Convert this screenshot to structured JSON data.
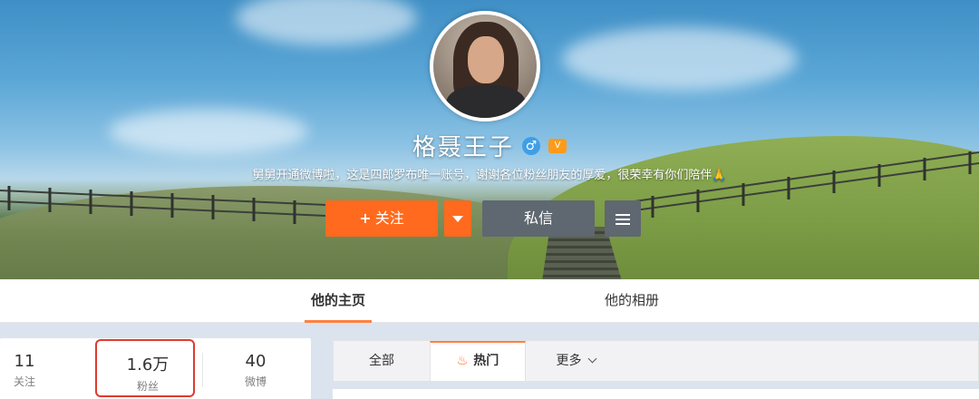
{
  "profile": {
    "name": "格聂王子",
    "gender_icon": "♂",
    "vip_icon": "vip-badge",
    "bio": "舅舅开通微博啦，这是四郎罗布唯一账号，谢谢各位粉丝朋友的厚爱，很荣幸有你们陪伴🙏"
  },
  "actions": {
    "follow_plus": "+",
    "follow_label": "关注",
    "message_label": "私信"
  },
  "tabs": [
    {
      "label": "他的主页",
      "active": true
    },
    {
      "label": "他的相册",
      "active": false
    }
  ],
  "stats": [
    {
      "value": "11",
      "label": "关注"
    },
    {
      "value": "1.6万",
      "label": "粉丝"
    },
    {
      "value": "40",
      "label": "微博"
    }
  ],
  "feed_tabs": {
    "all": "全部",
    "hot_icon": "♨",
    "hot": "热门",
    "more": "更多"
  },
  "colors": {
    "accent": "#ff6a1e",
    "secondary_button": "#5f6770",
    "highlight_box": "#e03a2e"
  }
}
